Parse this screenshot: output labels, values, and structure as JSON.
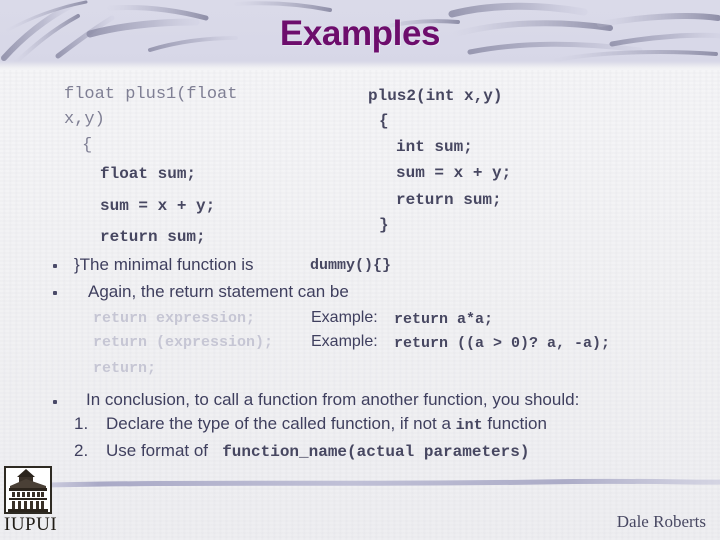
{
  "slide": {
    "title": "Examples",
    "title_color": "#6d0d6c",
    "header_bg": "#d8d8e8",
    "body_bg": "#f2f2f4",
    "body_text_color": "#3f3f5e"
  },
  "code_left": {
    "signature_line1": "float plus1(float",
    "signature_line2": "x,y)",
    "open_brace": "{",
    "lines": [
      "float sum;",
      "sum = x + y;",
      "return sum;"
    ]
  },
  "code_right": {
    "signature": "plus2(int x,y)",
    "open_brace": "{",
    "lines": [
      "int sum;",
      "sum = x + y;",
      "return sum;"
    ],
    "close_brace": "}"
  },
  "bullets": [
    {
      "marker": "•",
      "text": "}The minimal function is",
      "code": "dummy(){}"
    },
    {
      "marker": "•",
      "text": "Again, the return statement can be",
      "code": ""
    }
  ],
  "return_forms": [
    {
      "form": "return expression;",
      "example_label": "Example:",
      "example_code": "return a*a;"
    },
    {
      "form": "return (expression);",
      "example_label": "Example:",
      "example_code": "return ((a > 0)? a, -a);"
    },
    {
      "form": "return;",
      "example_label": "",
      "example_code": ""
    }
  ],
  "conclusion": {
    "marker": "•",
    "lead": "In conclusion, to call a function from another function, you should:",
    "items": [
      {
        "number": "1.",
        "text_before": "Declare the type of the called function, if not a ",
        "code": "int",
        "text_after": " function"
      },
      {
        "number": "2.",
        "text_before": "Use format of   ",
        "code": "function_name(actual parameters)",
        "text_after": ""
      }
    ]
  },
  "footer": {
    "logo_label": "IUPUI",
    "byline": "Dale Roberts"
  }
}
